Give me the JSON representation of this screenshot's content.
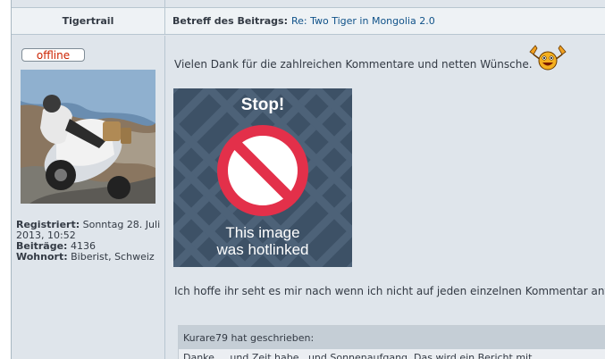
{
  "post": {
    "author": {
      "username": "Tigertrail",
      "status_badge": "offline",
      "registered_label": "Registriert:",
      "registered_value": "Sonntag 28. Juli 2013, 10:52",
      "posts_label": "Beiträge:",
      "posts_value": "4136",
      "location_label": "Wohnort:",
      "location_value": "Biberist, Schweiz"
    },
    "subject_label": "Betreff des Beitrags:",
    "subject_link": "Re: Two Tiger in Mongolia 2.0",
    "paragraph_1": "Vielen Dank für die zahlreichen Kommentare und netten Wünsche.",
    "hotlink_image": {
      "heading": "Stop!",
      "line_1": "This image",
      "line_2": "was hotlinked"
    },
    "paragraph_2": "Ich hoffe ihr seht es mir nach wenn ich nicht auf jeden einzelnen Kommentar antworte.",
    "quote": {
      "header": "Kurare79 hat geschrieben:",
      "body": "Danke, ...und Zeit habe...und Sonnenaufgang. Das wird ein Bericht mit"
    }
  },
  "colors": {
    "link": "#105289",
    "offline_text": "#cc2200",
    "panel_bg": "#dfe5eb",
    "header_bg": "#eef2f5",
    "quote_header_bg": "#c5ced6",
    "stop_red": "#e3304a",
    "hotlink_bg": "#3d5166"
  }
}
